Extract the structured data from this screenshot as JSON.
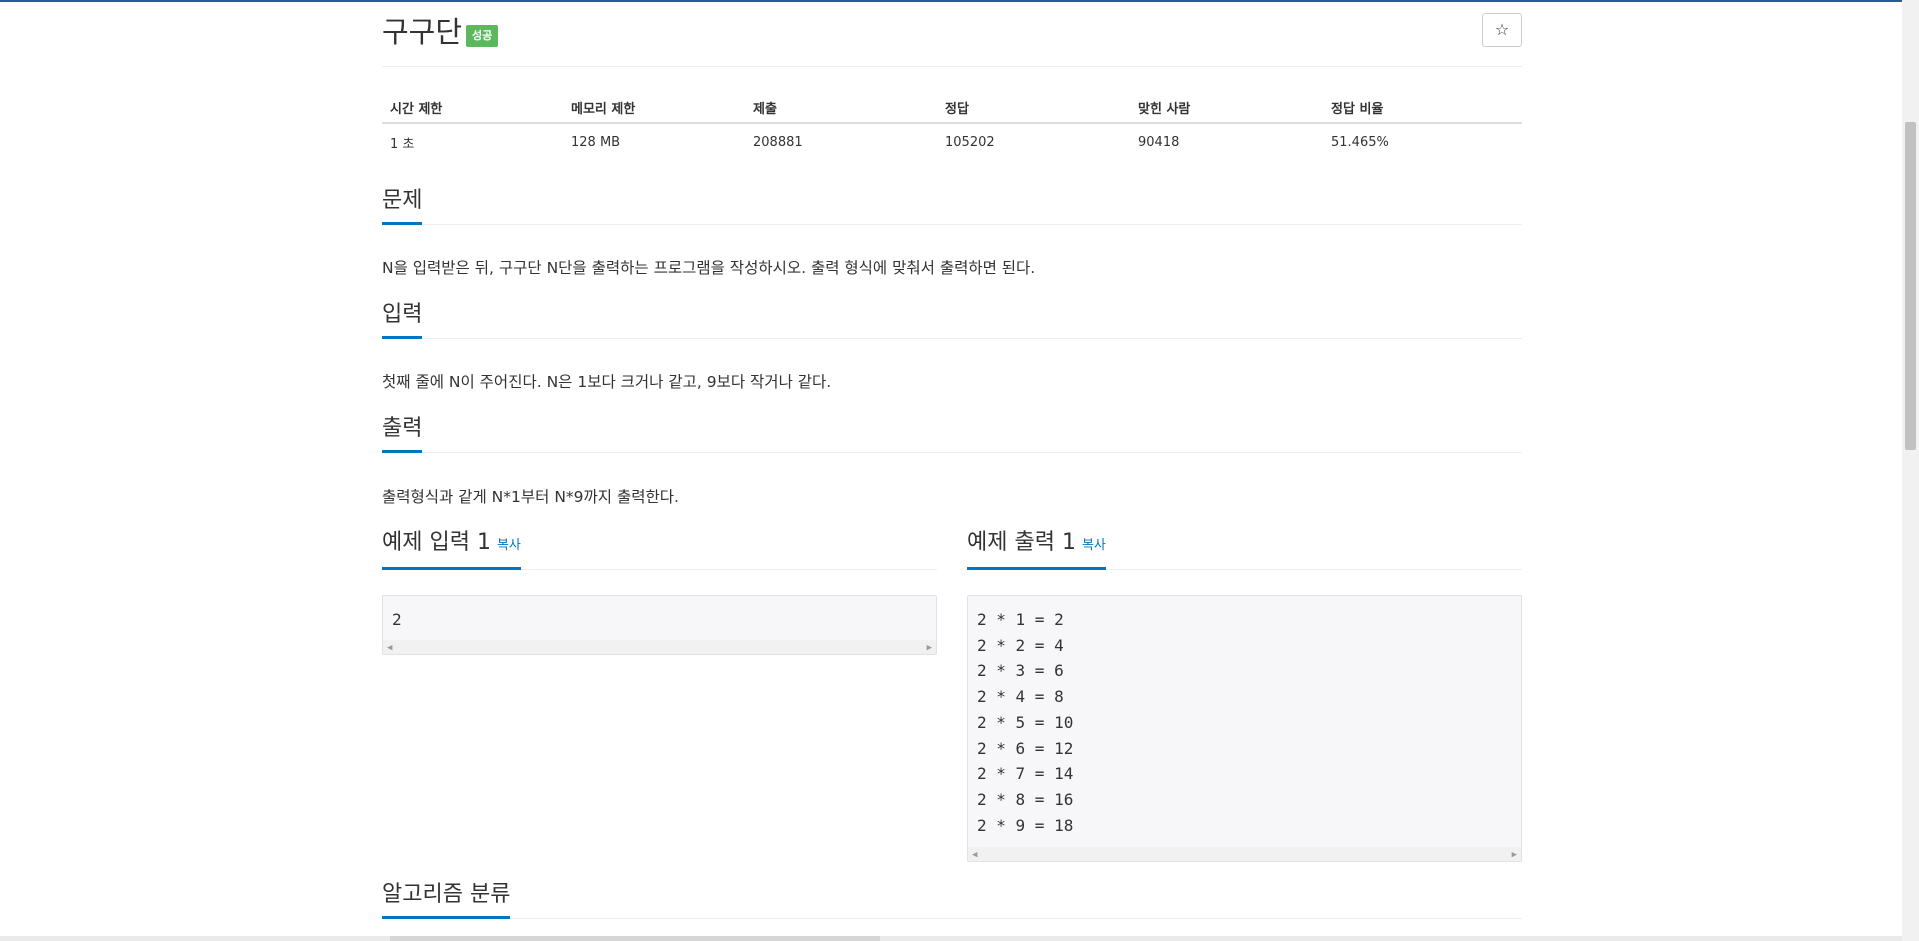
{
  "problem": {
    "title": "구구단",
    "badge": "성공",
    "star_icon": "☆"
  },
  "info_table": {
    "headers": [
      "시간 제한",
      "메모리 제한",
      "제출",
      "정답",
      "맞힌 사람",
      "정답 비율"
    ],
    "row": [
      "1 초",
      "128 MB",
      "208881",
      "105202",
      "90418",
      "51.465%"
    ]
  },
  "sections": {
    "description": {
      "title": "문제",
      "text": "N을 입력받은 뒤, 구구단 N단을 출력하는 프로그램을 작성하시오. 출력 형식에 맞춰서 출력하면 된다."
    },
    "input": {
      "title": "입력",
      "text": "첫째 줄에 N이 주어진다. N은 1보다 크거나 같고, 9보다 작거나 같다."
    },
    "output": {
      "title": "출력",
      "text": "출력형식과 같게 N*1부터 N*9까지 출력한다."
    },
    "sample_input": {
      "title": "예제 입력 1",
      "copy_label": "복사",
      "content": "2"
    },
    "sample_output": {
      "title": "예제 출력 1",
      "copy_label": "복사",
      "content": "2 * 1 = 2\n2 * 2 = 4\n2 * 3 = 6\n2 * 4 = 8\n2 * 5 = 10\n2 * 6 = 12\n2 * 7 = 14\n2 * 8 = 16\n2 * 9 = 18"
    },
    "algorithm": {
      "title": "알고리즘 분류"
    }
  },
  "colors": {
    "accent": "#0076c0",
    "success": "#5cb85c",
    "sample_bg": "#f7f7f9"
  }
}
